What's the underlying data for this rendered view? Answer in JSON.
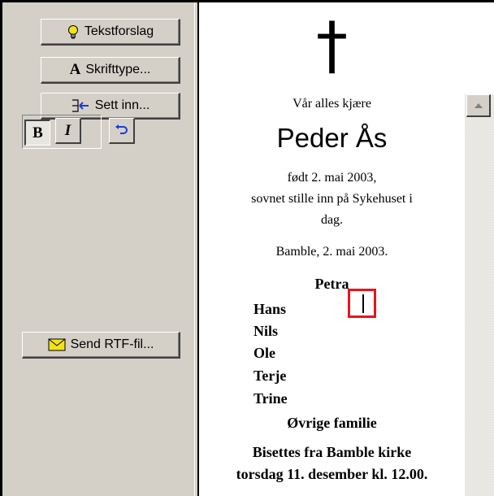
{
  "toolbar": {
    "text_suggestion": "Tekstforslag",
    "font_button": "Skrifttype...",
    "insert_button": "Sett inn...",
    "bold": "B",
    "italic": "I",
    "send_rtf": "Send RTF-fil..."
  },
  "document": {
    "cross": "†",
    "intro": "Vår alles kjære",
    "name": "Peder Ås",
    "born": "født 2. mai 2003,",
    "died_line1": "sovnet stille inn på Sykehuset i",
    "died_line2": "dag.",
    "place_date": "Bamble, 2. mai 2003.",
    "spouse": "Petra",
    "children": [
      "Hans",
      "Nils",
      "Ole",
      "Terje",
      "Trine"
    ],
    "others": "Øvrige familie",
    "funeral_line1": "Bisettes fra Bamble kirke",
    "funeral_line2": "torsdag 11. desember kl. 12.00."
  },
  "colors": {
    "highlight_box": "#e8141b",
    "bulb": "#f2e21a",
    "panel": "#d4d0c8"
  }
}
